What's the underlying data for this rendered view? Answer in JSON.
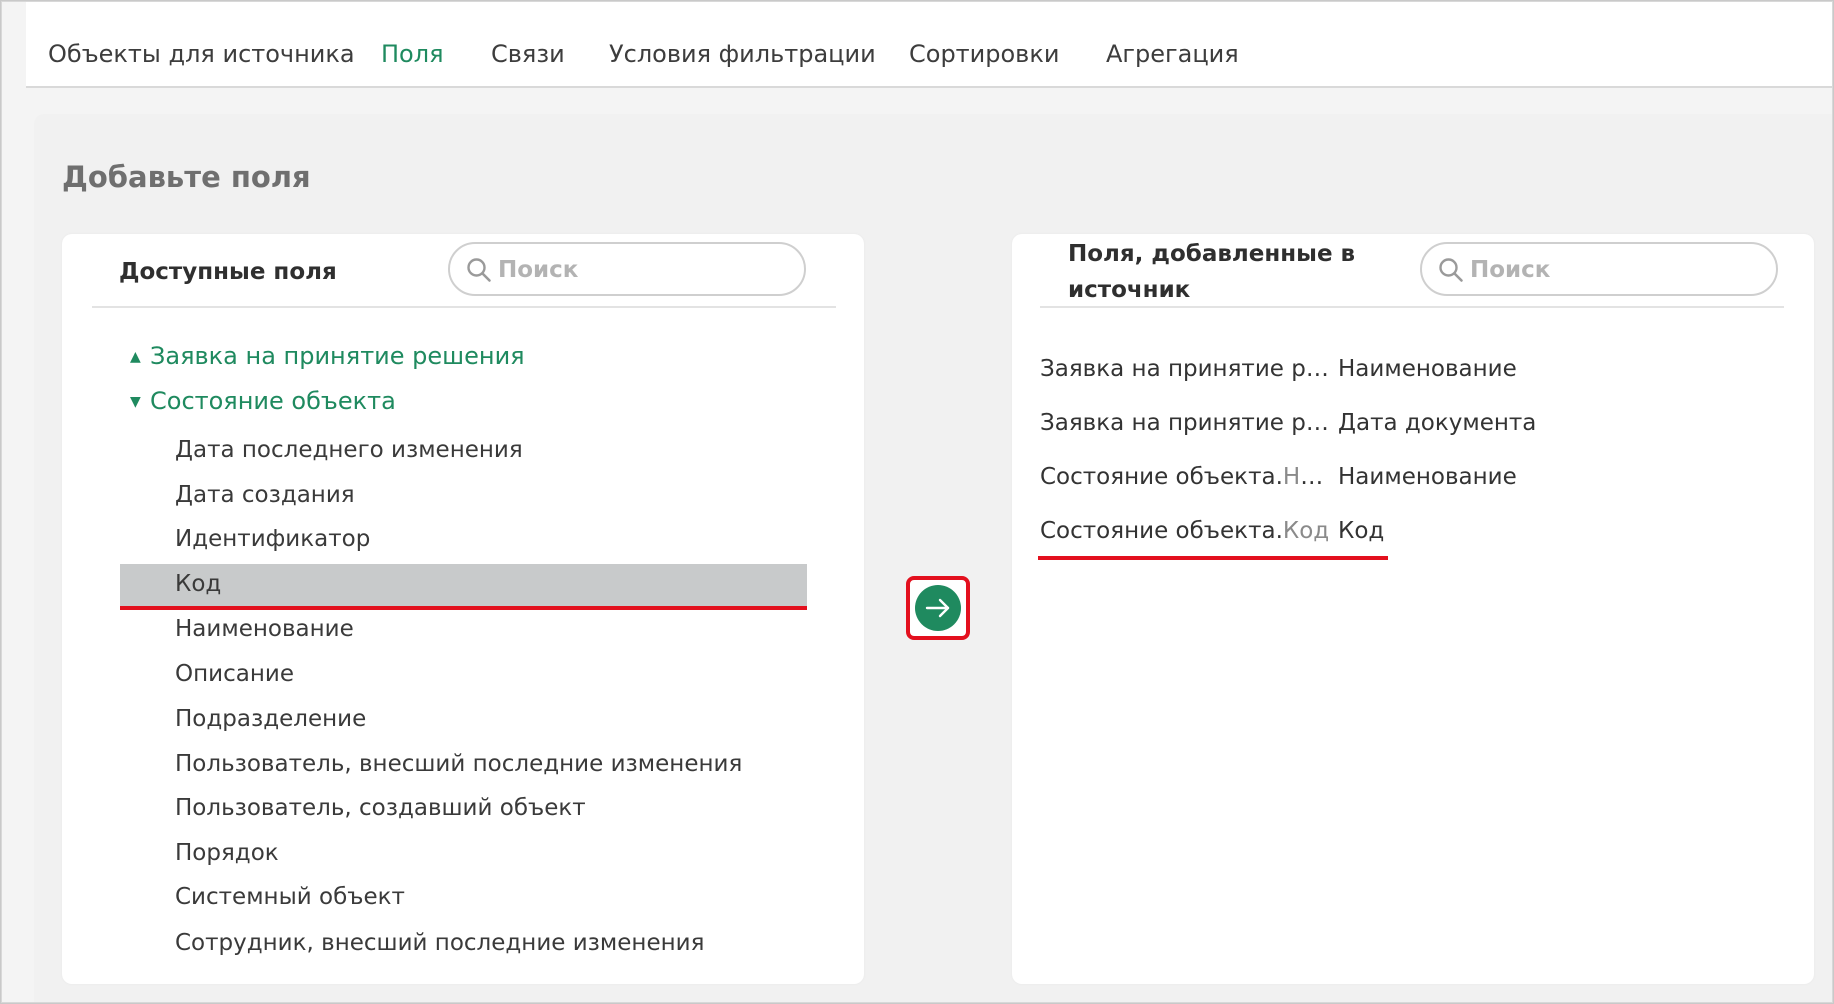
{
  "tabs": [
    {
      "label": "Объекты для источника",
      "active": false
    },
    {
      "label": "Поля",
      "active": true
    },
    {
      "label": "Связи",
      "active": false
    },
    {
      "label": "Условия фильтрации",
      "active": false
    },
    {
      "label": "Сортировки",
      "active": false
    },
    {
      "label": "Агрегация",
      "active": false
    }
  ],
  "card_title": "Добавьте поля",
  "available": {
    "title": "Доступные поля",
    "search_placeholder": "Поиск",
    "groups": [
      {
        "label": "Заявка на принятие решения",
        "expanded": false
      },
      {
        "label": "Состояние объекта",
        "expanded": true
      }
    ],
    "items": [
      "Дата последнего изменения",
      "Дата создания",
      "Идентификатор",
      "Код",
      "Наименование",
      "Описание",
      "Подразделение",
      "Пользователь, внесший последние изменения",
      "Пользователь, создавший объект",
      "Порядок",
      "Системный объект",
      "Сотрудник, внесший последние изменения"
    ],
    "selected_item": "Код"
  },
  "added": {
    "title_line1": "Поля, добавленные в",
    "title_line2": "источник",
    "search_placeholder": "Поиск",
    "rows": [
      {
        "path": "Заявка на принятие ре…",
        "path_suffix": "",
        "name": "Наименование"
      },
      {
        "path": "Заявка на принятие ре…",
        "path_suffix": "",
        "name": "Дата документа"
      },
      {
        "path": "Состояние объекта.",
        "path_suffix": "На…",
        "name": "Наименование"
      },
      {
        "path": "Состояние объекта.",
        "path_suffix": "Код",
        "name": "Код"
      }
    ]
  },
  "colors": {
    "accent": "#1f8a5f",
    "highlight": "#e3101e",
    "selected_bg": "#c8cacb"
  },
  "icons": {
    "search": "search-icon",
    "add": "arrow-right-icon",
    "group_collapsed": "caret-up-icon",
    "group_expanded": "caret-down-icon"
  }
}
